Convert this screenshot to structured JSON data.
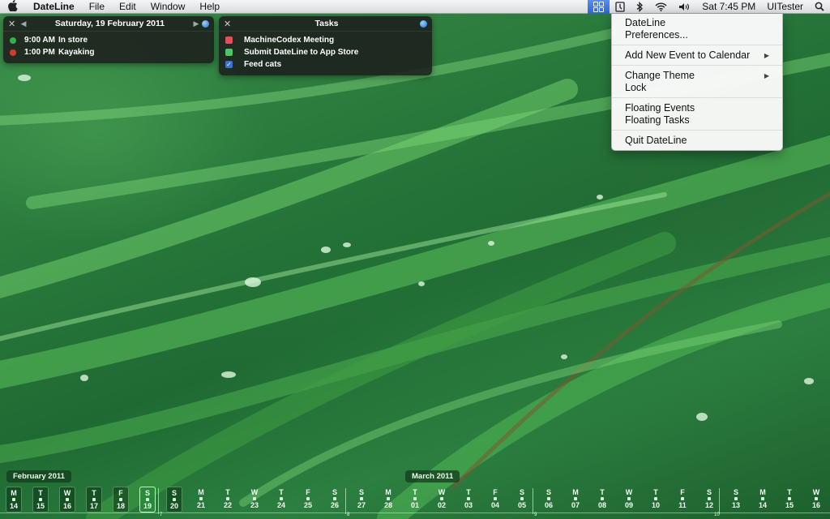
{
  "menubar": {
    "apple": "",
    "app_name": "DateLine",
    "menus": [
      "File",
      "Edit",
      "Window",
      "Help"
    ],
    "status": {
      "app_icon": "dateline-grid-icon",
      "clock": "Sat 7:45 PM",
      "user": "UITester"
    }
  },
  "dropdown": {
    "groups": [
      [
        {
          "label": "DateLine",
          "submenu": false
        },
        {
          "label": "Preferences...",
          "submenu": false
        }
      ],
      [
        {
          "label": "Add New Event to Calendar",
          "submenu": true
        }
      ],
      [
        {
          "label": "Change Theme",
          "submenu": true
        },
        {
          "label": "Lock",
          "submenu": false
        }
      ],
      [
        {
          "label": "Floating Events",
          "submenu": false
        },
        {
          "label": "Floating Tasks",
          "submenu": false
        }
      ],
      [
        {
          "label": "Quit DateLine",
          "submenu": false
        }
      ]
    ]
  },
  "events_panel": {
    "date": "Saturday, 19 February 2011",
    "events": [
      {
        "time": "9:00 AM",
        "title": "In store",
        "color": "#2fb34a"
      },
      {
        "time": "1:00 PM",
        "title": "Kayaking",
        "color": "#d63a2f"
      }
    ]
  },
  "tasks_panel": {
    "title": "Tasks",
    "tasks": [
      {
        "title": "MachineCodex Meeting",
        "color": "#e0505a",
        "checked": false
      },
      {
        "title": "Submit DateLine to App Store",
        "color": "#4fc36a",
        "checked": false
      },
      {
        "title": "Feed cats",
        "color": "#3e6fcf",
        "checked": true
      }
    ]
  },
  "timeline": {
    "months": [
      "February 2011",
      "March 2011"
    ],
    "days": [
      {
        "d": "M",
        "n": "14",
        "boxed": true
      },
      {
        "d": "T",
        "n": "15",
        "boxed": true
      },
      {
        "d": "W",
        "n": "16",
        "boxed": true
      },
      {
        "d": "T",
        "n": "17",
        "boxed": true
      },
      {
        "d": "F",
        "n": "18",
        "boxed": true
      },
      {
        "d": "S",
        "n": "19",
        "boxed": true,
        "today": true
      },
      {
        "d": "S",
        "n": "20",
        "boxed": true
      },
      {
        "d": "M",
        "n": "21"
      },
      {
        "d": "T",
        "n": "22"
      },
      {
        "d": "W",
        "n": "23"
      },
      {
        "d": "T",
        "n": "24"
      },
      {
        "d": "F",
        "n": "25"
      },
      {
        "d": "S",
        "n": "26"
      },
      {
        "d": "S",
        "n": "27"
      },
      {
        "d": "M",
        "n": "28"
      },
      {
        "d": "T",
        "n": "01"
      },
      {
        "d": "W",
        "n": "02"
      },
      {
        "d": "T",
        "n": "03"
      },
      {
        "d": "F",
        "n": "04"
      },
      {
        "d": "S",
        "n": "05"
      },
      {
        "d": "S",
        "n": "06"
      },
      {
        "d": "M",
        "n": "07"
      },
      {
        "d": "T",
        "n": "08"
      },
      {
        "d": "W",
        "n": "09"
      },
      {
        "d": "T",
        "n": "10"
      },
      {
        "d": "F",
        "n": "11"
      },
      {
        "d": "S",
        "n": "12"
      },
      {
        "d": "S",
        "n": "13"
      },
      {
        "d": "M",
        "n": "14"
      },
      {
        "d": "T",
        "n": "15"
      },
      {
        "d": "W",
        "n": "16"
      }
    ],
    "week_numbers": [
      "7",
      "8",
      "9",
      "10"
    ]
  }
}
